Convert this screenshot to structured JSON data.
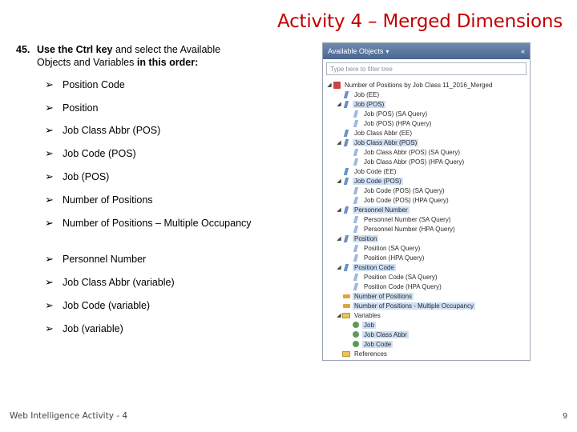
{
  "slide": {
    "title": "Activity 4 – Merged Dimensions",
    "footer_left": "Web Intelligence Activity - 4",
    "page_number": "9"
  },
  "instruction": {
    "number": "45.",
    "part1": "Use the Ctrl key",
    "part2": " and select the Available",
    "part3": "Objects and Variables ",
    "part4": "in this order:"
  },
  "steps": [
    "Position Code",
    "Position",
    "Job Class Abbr (POS)",
    "Job Code (POS)",
    "Job (POS)",
    "Number of Positions",
    "Number of Positions – Multiple Occupancy",
    "Personnel Number",
    "Job Class Abbr (variable)",
    "Job Code (variable)",
    "Job (variable)"
  ],
  "arrow_glyph": "➢",
  "panel": {
    "title": "Available Objects",
    "dropdown_glyph": "▾",
    "collapse_glyph": "«",
    "filter_placeholder": "Type here to filter tree",
    "tree": [
      {
        "label": "Number of Positions by Job Class 11_2016_Merged",
        "level": 0,
        "toggle": "◢",
        "icon": "query",
        "selected": false
      },
      {
        "label": "Job (EE)",
        "level": 1,
        "toggle": "",
        "icon": "dim",
        "selected": false
      },
      {
        "label": "Job (POS)",
        "level": 1,
        "toggle": "◢",
        "icon": "dim",
        "selected": true
      },
      {
        "label": "Job (POS) (SA Query)",
        "level": 2,
        "toggle": "",
        "icon": "dim-light",
        "selected": false
      },
      {
        "label": "Job (POS) (HPA Query)",
        "level": 2,
        "toggle": "",
        "icon": "dim-light",
        "selected": false
      },
      {
        "label": "Job Class Abbr (EE)",
        "level": 1,
        "toggle": "",
        "icon": "dim",
        "selected": false
      },
      {
        "label": "Job Class Abbr (POS)",
        "level": 1,
        "toggle": "◢",
        "icon": "dim",
        "selected": true
      },
      {
        "label": "Job Class Abbr (POS) (SA Query)",
        "level": 2,
        "toggle": "",
        "icon": "dim-light",
        "selected": false
      },
      {
        "label": "Job Class Abbr (POS) (HPA Query)",
        "level": 2,
        "toggle": "",
        "icon": "dim-light",
        "selected": false
      },
      {
        "label": "Job Code (EE)",
        "level": 1,
        "toggle": "",
        "icon": "dim",
        "selected": false
      },
      {
        "label": "Job Code (POS)",
        "level": 1,
        "toggle": "◢",
        "icon": "dim",
        "selected": true
      },
      {
        "label": "Job Code (POS) (SA Query)",
        "level": 2,
        "toggle": "",
        "icon": "dim-light",
        "selected": false
      },
      {
        "label": "Job Code (POS) (HPA Query)",
        "level": 2,
        "toggle": "",
        "icon": "dim-light",
        "selected": false
      },
      {
        "label": "Personnel Number",
        "level": 1,
        "toggle": "◢",
        "icon": "dim",
        "selected": true
      },
      {
        "label": "Personnel Number (SA Query)",
        "level": 2,
        "toggle": "",
        "icon": "dim-light",
        "selected": false
      },
      {
        "label": "Personnel Number (HPA Query)",
        "level": 2,
        "toggle": "",
        "icon": "dim-light",
        "selected": false
      },
      {
        "label": "Position",
        "level": 1,
        "toggle": "◢",
        "icon": "dim",
        "selected": true
      },
      {
        "label": "Position (SA Query)",
        "level": 2,
        "toggle": "",
        "icon": "dim-light",
        "selected": false
      },
      {
        "label": "Position (HPA Query)",
        "level": 2,
        "toggle": "",
        "icon": "dim-light",
        "selected": false
      },
      {
        "label": "Position Code",
        "level": 1,
        "toggle": "◢",
        "icon": "dim",
        "selected": true
      },
      {
        "label": "Position Code (SA Query)",
        "level": 2,
        "toggle": "",
        "icon": "dim-light",
        "selected": false
      },
      {
        "label": "Position Code (HPA Query)",
        "level": 2,
        "toggle": "",
        "icon": "dim-light",
        "selected": false
      },
      {
        "label": "Number of Positions",
        "level": 1,
        "toggle": "",
        "icon": "measure",
        "selected": true
      },
      {
        "label": "Number of Positions - Multiple Occupancy",
        "level": 1,
        "toggle": "",
        "icon": "measure",
        "selected": true
      },
      {
        "label": "Variables",
        "level": 1,
        "toggle": "◢",
        "icon": "folder",
        "selected": false
      },
      {
        "label": "Job",
        "level": 2,
        "toggle": "",
        "icon": "variable",
        "selected": true
      },
      {
        "label": "Job Class Abbr",
        "level": 2,
        "toggle": "",
        "icon": "variable",
        "selected": true
      },
      {
        "label": "Job Code",
        "level": 2,
        "toggle": "",
        "icon": "variable",
        "selected": true
      },
      {
        "label": "References",
        "level": 1,
        "toggle": "",
        "icon": "folder",
        "selected": false
      }
    ]
  }
}
